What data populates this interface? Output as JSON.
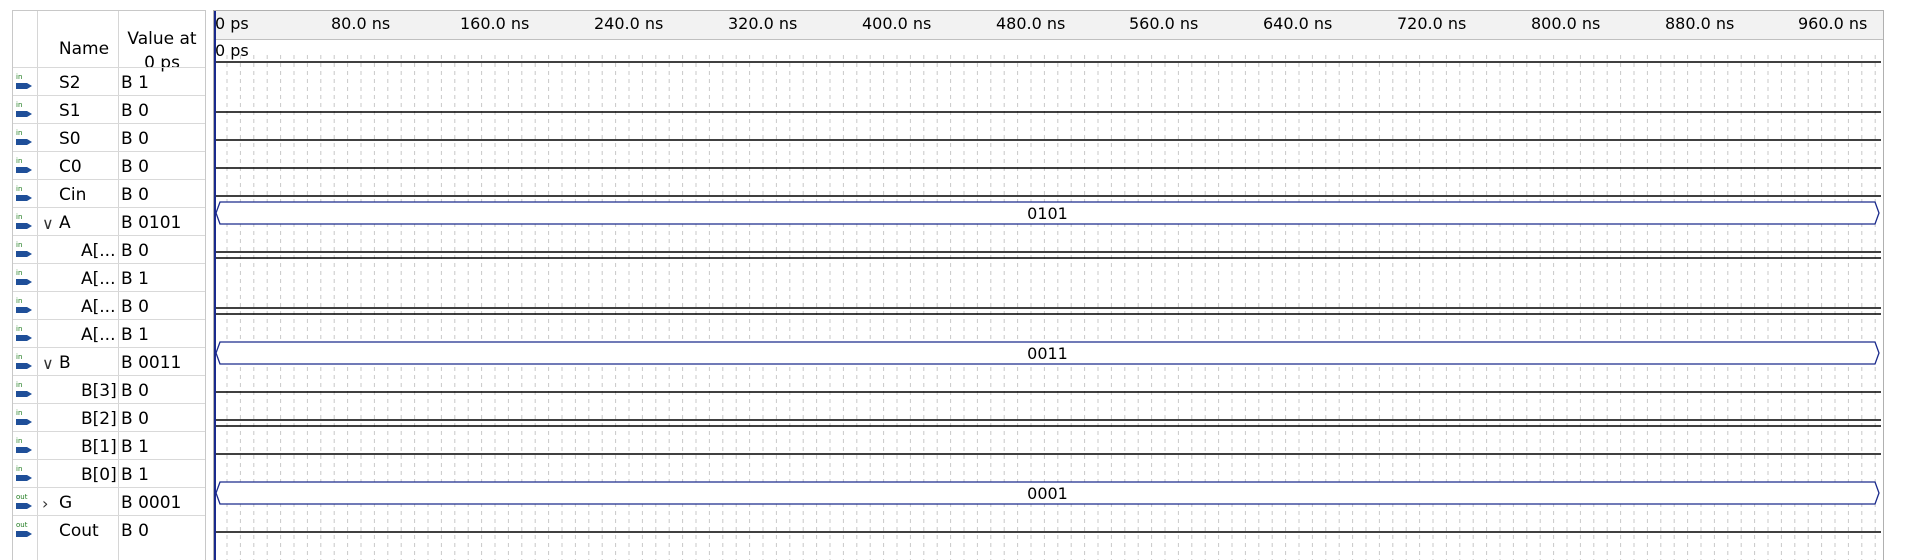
{
  "header": {
    "name_label": "Name",
    "value_label_line1": "Value at",
    "value_label_line2": "0 ps"
  },
  "time_ruler": {
    "ticks": [
      "0 ps",
      "80.0 ns",
      "160.0 ns",
      "240.0 ns",
      "320.0 ns",
      "400.0 ns",
      "480.0 ns",
      "560.0 ns",
      "640.0 ns",
      "720.0 ns",
      "800.0 ns",
      "880.0 ns",
      "960.0 ns"
    ],
    "marker_label": "0 ps"
  },
  "signals": [
    {
      "name": "S2",
      "value": "B 1",
      "pin": "in",
      "indent": 0,
      "expander": ""
    },
    {
      "name": "S1",
      "value": "B 0",
      "pin": "in",
      "indent": 0,
      "expander": ""
    },
    {
      "name": "S0",
      "value": "B 0",
      "pin": "in",
      "indent": 0,
      "expander": ""
    },
    {
      "name": "C0",
      "value": "B 0",
      "pin": "in",
      "indent": 0,
      "expander": ""
    },
    {
      "name": "Cin",
      "value": "B 0",
      "pin": "in",
      "indent": 0,
      "expander": ""
    },
    {
      "name": "A",
      "value": "B 0101",
      "pin": "in",
      "indent": 0,
      "expander": "expanded",
      "bus": "0101"
    },
    {
      "name": "A[...",
      "value": "B 0",
      "pin": "in",
      "indent": 1,
      "expander": ""
    },
    {
      "name": "A[...",
      "value": "B 1",
      "pin": "in",
      "indent": 1,
      "expander": ""
    },
    {
      "name": "A[...",
      "value": "B 0",
      "pin": "in",
      "indent": 1,
      "expander": ""
    },
    {
      "name": "A[...",
      "value": "B 1",
      "pin": "in",
      "indent": 1,
      "expander": ""
    },
    {
      "name": "B",
      "value": "B 0011",
      "pin": "in",
      "indent": 0,
      "expander": "expanded",
      "bus": "0011"
    },
    {
      "name": "B[3]",
      "value": "B 0",
      "pin": "in",
      "indent": 1,
      "expander": ""
    },
    {
      "name": "B[2]",
      "value": "B 0",
      "pin": "in",
      "indent": 1,
      "expander": ""
    },
    {
      "name": "B[1]",
      "value": "B 1",
      "pin": "in",
      "indent": 1,
      "expander": ""
    },
    {
      "name": "B[0]",
      "value": "B 1",
      "pin": "in",
      "indent": 1,
      "expander": ""
    },
    {
      "name": "G",
      "value": "B 0001",
      "pin": "out",
      "indent": 0,
      "expander": "collapsed",
      "bus": "0001"
    },
    {
      "name": "Cout",
      "value": "B 0",
      "pin": "out",
      "indent": 0,
      "expander": ""
    }
  ],
  "colors": {
    "bus_outline": "#1a2a8c",
    "waveform": "#000000",
    "grid": "#c8c8c8",
    "cursor": "#1a2a8c"
  }
}
